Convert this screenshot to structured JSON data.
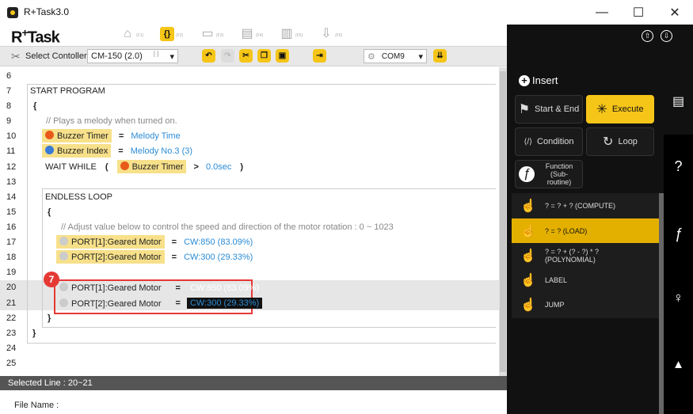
{
  "window": {
    "title": "R+Task3.0",
    "min": "—",
    "max": "☐",
    "close": "✕"
  },
  "logo": {
    "main": "R",
    "plus": "+",
    "task": "Task"
  },
  "main_icons": [
    {
      "glyph": "⌂",
      "fkey": "(F1)",
      "name": "home-icon"
    },
    {
      "glyph": "{}",
      "fkey": "(F2)",
      "name": "task-code-icon"
    },
    {
      "glyph": "▭",
      "fkey": "(F3)",
      "name": "monitor-icon"
    },
    {
      "glyph": "▤",
      "fkey": "(F4)",
      "name": "film-icon"
    },
    {
      "glyph": "▥",
      "fkey": "(F5)",
      "name": "clapper-icon"
    },
    {
      "glyph": "⇩",
      "fkey": "(F6)",
      "name": "download-icon"
    }
  ],
  "controller": {
    "label": "Select Contoller",
    "value": "CM-150 (2.0)",
    "hint": "[·]",
    "port_value": "COM9"
  },
  "editor": {
    "lines": [
      "6",
      "7",
      "8",
      "9",
      "10",
      "11",
      "12",
      "13",
      "14",
      "15",
      "16",
      "17",
      "18",
      "19",
      "20",
      "21",
      "22",
      "23",
      "24",
      "25"
    ],
    "start_program": "START PROGRAM",
    "open_brace": "{",
    "close_brace": "}",
    "comment1": "//   Plays a melody when turned on.",
    "buzzer_timer": "Buzzer Timer",
    "eq": "=",
    "melody_time": "Melody Time",
    "buzzer_index": "Buzzer Index",
    "melody_no": "Melody No.3 (3)",
    "wait_while": "WAIT WHILE",
    "paren_open": "(",
    "paren_close": ")",
    "gt": ">",
    "zero_sec": "0.0sec",
    "endless_loop": "ENDLESS LOOP",
    "comment2": "//   Adjust value below to control the speed and direction of the motor rotation : 0 ~ 1023",
    "port1": "PORT[1]:Geared Motor",
    "port2": "PORT[2]:Geared Motor",
    "cw850": "CW:850 (83.09%)",
    "cw300": "CW:300 (29.33%)",
    "badge": "7"
  },
  "status": {
    "selected": "Selected Line : 20~21",
    "filename": "File Name :"
  },
  "panel": {
    "insert": "Insert",
    "categories": [
      {
        "label": "Start & End",
        "icon": "⚑"
      },
      {
        "label": "Execute",
        "icon": "✳"
      },
      {
        "label": "Condition",
        "icon": "⟨/⟩"
      },
      {
        "label": "Loop",
        "icon": "↻"
      },
      {
        "label": "Function (Sub-routine)",
        "icon": "ƒ"
      }
    ],
    "commands": [
      "? = ? + ?  (COMPUTE)",
      "? = ?  (LOAD)",
      "? = ? + (? - ?) * ?  (POLYNOMIAL)",
      "LABEL",
      "JUMP"
    ],
    "side": {
      "help": "?",
      "func": "ƒ",
      "pin": "♀",
      "warn": "▲"
    }
  },
  "colors": {
    "accent": "#f5c518",
    "highlight": "#e3b000",
    "value": "#2a8bd6",
    "badge": "#e53935"
  }
}
